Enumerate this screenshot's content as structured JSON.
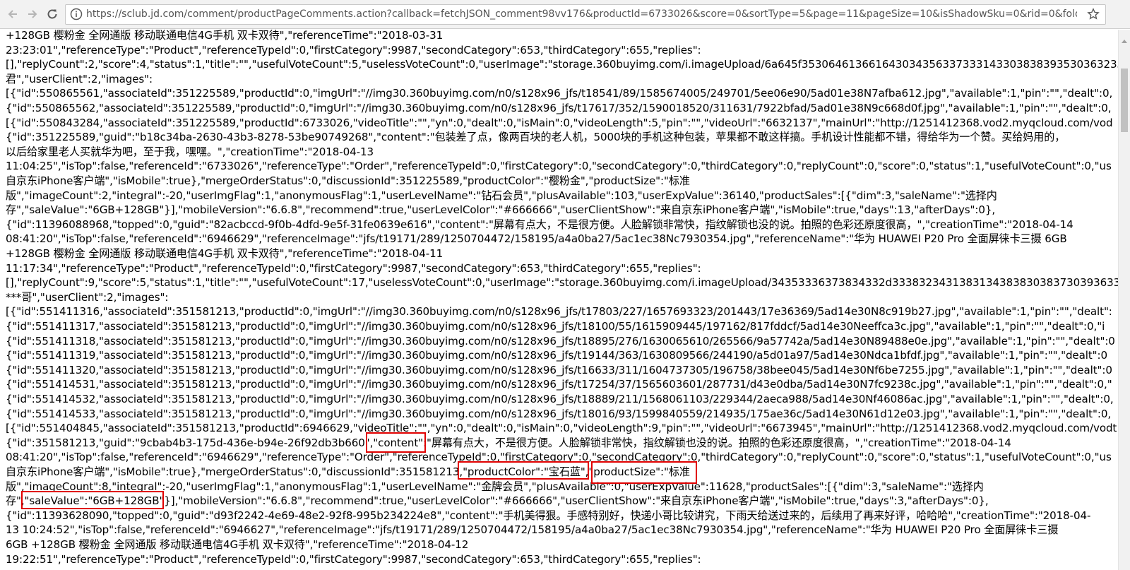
{
  "browser": {
    "url": "https://sclub.jd.com/comment/productPageComments.action?callback=fetchJSON_comment98vv176&productId=6733026&score=0&sortType=5&page=11&pageSize=10&isShadowSku=0&rid=0&fold=1",
    "icons": {
      "back": "arrow-left-icon",
      "forward": "arrow-right-icon",
      "reload": "reload-icon",
      "info": "info-icon",
      "bookmark": "star-icon"
    }
  },
  "colors": {
    "highlight": "#e00000",
    "text": "#000000"
  },
  "lines": [
    "+128GB 樱粉金 全网通版 移动联通电信4G手机 双卡双待\",\"referenceTime\":\"2018-03-31",
    "23:23:01\",\"referenceType\":\"Product\",\"referenceTypeId\":0,\"firstCategory\":9987,\"secondCategory\":653,\"thirdCategory\":655,\"replies\":",
    "[],\"replyCount\":2,\"score\":4,\"status\":1,\"title\":\"\",\"usefulVoteCount\":5,\"uselessVoteCount\":0,\"userImage\":\"storage.360buyimg.com/i.imageUpload/6a645f353064613661643034356337333143303838393530363233",
    "君\",\"userClient\":2,\"images\":",
    "[{\"id\":550865561,\"associateId\":351225589,\"productId\":0,\"imgUrl\":\"//img30.360buyimg.com/n0/s128x96_jfs/t18541/89/1585674005/249701/5ee06e90/5ad01e38N7afba612.jpg\",\"available\":1,\"pin\":\"\",\"dealt\":0,",
    "{\"id\":550865562,\"associateId\":351225589,\"productId\":0,\"imgUrl\":\"//img30.360buyimg.com/n0/s128x96_jfs/t17617/352/1590018520/311631/7922bfad/5ad01e38N9c668d0f.jpg\",\"available\":1,\"pin\":\"\",\"dealt\":0,",
    "[{\"id\":550843284,\"associateId\":351225589,\"productId\":6733026,\"videoTitle\":\"\",\"yn\":0,\"dealt\":0,\"isMain\":0,\"videoLength\":5,\"pin\":\"\",\"videoUrl\":\"6632137\",\"mainUrl\":\"http://1251412368.vod2.myqcloud.com/vod",
    "{\"id\":351225589,\"guid\":\"b18c34ba-2630-43b3-8278-53be90749268\",\"content\":\"包装差了点，像两百块的老人机，5000块的手机这种包装，苹果都不敢这样搞。手机设计性能都不错，得给华为一个赞。买给妈用的，",
    "以后给家里老人买就华为吧，至于我，嘿嘿。\",\"creationTime\":\"2018-04-13",
    "11:04:25\",\"isTop\":false,\"referenceId\":\"6733026\",\"referenceType\":\"Order\",\"referenceTypeId\":0,\"firstCategory\":0,\"secondCategory\":0,\"thirdCategory\":0,\"replyCount\":0,\"score\":0,\"status\":1,\"usefulVoteCount\":0,\"us",
    "自京东iPhone客户端\",\"isMobile\":true},\"mergeOrderStatus\":0,\"discussionId\":351225589,\"productColor\":\"樱粉金\",\"productSize\":\"标准",
    "版\",\"imageCount\":2,\"integral\":-20,\"userImgFlag\":1,\"anonymousFlag\":1,\"userLevelName\":\"钻石会员\",\"plusAvailable\":103,\"userExpValue\":36140,\"productSales\":[{\"dim\":3,\"saleName\":\"选择内",
    "存\",\"saleValue\":\"6GB+128GB\"}],\"mobileVersion\":\"6.6.8\",\"recommend\":true,\"userLevelColor\":\"#666666\",\"userClientShow\":\"来自京东iPhone客户端\",\"isMobile\":true,\"days\":13,\"afterDays\":0},",
    "{\"id\":11396088968,\"topped\":0,\"guid\":\"82acbccd-9f0b-4dfd-9e5f-31fe0639e616\",\"content\":\"屏幕有点大，不是很方便。人脸解锁非常快，指纹解锁也没的说。拍照的色彩还原度很高，\",\"creationTime\":\"2018-04-14",
    "08:41:20\",\"isTop\":false,\"referenceId\":\"6946629\",\"referenceImage\":\"jfs/t19171/289/1250704472/158195/a4a0ba27/5ac1ec38Nc7930354.jpg\",\"referenceName\":\"华为 HUAWEI P20 Pro 全面屏徕卡三摄 6GB",
    "+128GB 樱粉金 全网通版 移动联通电信4G手机 双卡双待\",\"referenceTime\":\"2018-04-11",
    "11:17:34\",\"referenceType\":\"Product\",\"referenceTypeId\":0,\"firstCategory\":9987,\"secondCategory\":653,\"thirdCategory\":655,\"replies\":",
    "[],\"replyCount\":9,\"score\":5,\"status\":1,\"title\":\"\",\"usefulVoteCount\":17,\"uselessVoteCount\":0,\"userImage\":\"storage.360buyimg.com/i.imageUpload/34353336373834332d33383234313831343838303837303936333",
    "***哥\",\"userClient\":2,\"images\":",
    "[{\"id\":551411316,\"associateId\":351581213,\"productId\":0,\"imgUrl\":\"//img30.360buyimg.com/n0/s128x96_jfs/t17803/227/1657693323/201443/17e36369/5ad14e30N8c919b27.jpg\",\"available\":1,\"pin\":\"\",\"dealt\":",
    "{\"id\":551411317,\"associateId\":351581213,\"productId\":0,\"imgUrl\":\"//img30.360buyimg.com/n0/s128x96_jfs/t18100/55/1615909445/197162/817fddcf/5ad14e30Neeffca3c.jpg\",\"available\":1,\"pin\":\"\",\"dealt\":0,\"i",
    "{\"id\":551411318,\"associateId\":351581213,\"productId\":0,\"imgUrl\":\"//img30.360buyimg.com/n0/s128x96_jfs/t18895/276/1630065610/265566/9a57742a/5ad14e30N89488e0e.jpg\",\"available\":1,\"pin\":\"\",\"dealt\":0",
    "{\"id\":551411319,\"associateId\":351581213,\"productId\":0,\"imgUrl\":\"//img30.360buyimg.com/n0/s128x96_jfs/t19144/363/1630809566/244190/a5d01a97/5ad14e30Ndca1bfdf.jpg\",\"available\":1,\"pin\":\"\",\"dealt\":0",
    "{\"id\":551411320,\"associateId\":351581213,\"productId\":0,\"imgUrl\":\"//img30.360buyimg.com/n0/s128x96_jfs/t16633/311/1604737305/196758/38bee045/5ad14e30Nf6be7255.jpg\",\"available\":1,\"pin\":\"\",\"dealt\":0",
    "{\"id\":551414531,\"associateId\":351581213,\"productId\":0,\"imgUrl\":\"//img30.360buyimg.com/n0/s128x96_jfs/t17254/37/1565603601/287731/d43e0dba/5ad14e30N7fc9238c.jpg\",\"available\":1,\"pin\":\"\",\"dealt\":0,\"",
    "{\"id\":551414532,\"associateId\":351581213,\"productId\":0,\"imgUrl\":\"//img30.360buyimg.com/n0/s128x96_jfs/t18889/211/1568061103/229344/2aeca988/5ad14e30Nf46086ac.jpg\",\"available\":1,\"pin\":\"\",\"dealt\":0,",
    "{\"id\":551414533,\"associateId\":351581213,\"productId\":0,\"imgUrl\":\"//img30.360buyimg.com/n0/s128x96_jfs/t18016/93/1599840559/214935/175ae36c/5ad14e30N61d12e03.jpg\",\"available\":1,\"pin\":\"\",\"dealt\":0,",
    "[{\"id\":551404845,\"associateId\":351581213,\"productId\":6946629,\"videoTitle\":\"\",\"yn\":0,\"dealt\":0,\"isMain\":0,\"videoLength\":9,\"pin\":\"\",\"videoUrl\":\"6673945\",\"mainUrl\":\"http://1251412368.vod2.myqcloud.com/vodt",
    "{\"id\":351581213,\"guid\":\"9cbab4b3-175d-436e-b94e-26f92db3b660\",\"content\":\"屏幕有点大，不是很方便。人脸解锁非常快，指纹解锁也没的说。拍照的色彩还原度很高，\",\"creationTime\":\"2018-04-14",
    "08:41:20\",\"isTop\":false,\"referenceId\":\"6946629\",\"referenceType\":\"Order\",\"referenceTypeId\":0,\"firstCategory\":0,\"secondCategory\":0,\"thirdCategory\":0,\"replyCount\":0,\"score\":0,\"status\":1,\"usefulVoteCount\":0,\"us",
    "自京东iPhone客户端\",\"isMobile\":true},\"mergeOrderStatus\":0,\"discussionId\":351581213,\"productColor\":\"宝石蓝\",\"productSize\":\"标准",
    "版\",\"imageCount\":8,\"integral\":-20,\"userImgFlag\":1,\"anonymousFlag\":1,\"userLevelName\":\"金牌会员\",\"plusAvailable\":0,\"userExpValue\":11628,\"productSales\":[{\"dim\":3,\"saleName\":\"选择内",
    "存\",\"saleValue\":\"6GB+128GB\"}],\"mobileVersion\":\"6.6.8\",\"recommend\":true,\"userLevelColor\":\"#666666\",\"userClientShow\":\"来自京东iPhone客户端\",\"isMobile\":true,\"days\":3,\"afterDays\":0},",
    "{\"id\":11393628090,\"topped\":0,\"guid\":\"d93f2242-4e69-48e2-92f8-995b234224e8\",\"content\":\"手机美得狠。手感特别好，快递小哥比较讲究，下雨天给送过来的，后续用了再来好评，哈哈哈\",\"creationTime\":\"2018-04-",
    "13 10:24:52\",\"isTop\":false,\"referenceId\":\"6946627\",\"referenceImage\":\"jfs/t19171/289/1250704472/158195/a4a0ba27/5ac1ec38Nc7930354.jpg\",\"referenceName\":\"华为 HUAWEI P20 Pro 全面屏徕卡三摄",
    "6GB +128GB 樱粉金 全网通版 移动联通电信4G手机 双卡双待\",\"referenceTime\":\"2018-04-12",
    "19:22:51\",\"referenceType\":\"Product\",\"referenceTypeId\":0,\"firstCategory\":9987,\"secondCategory\":653,\"thirdCategory\":655,\"replies\":"
  ]
}
